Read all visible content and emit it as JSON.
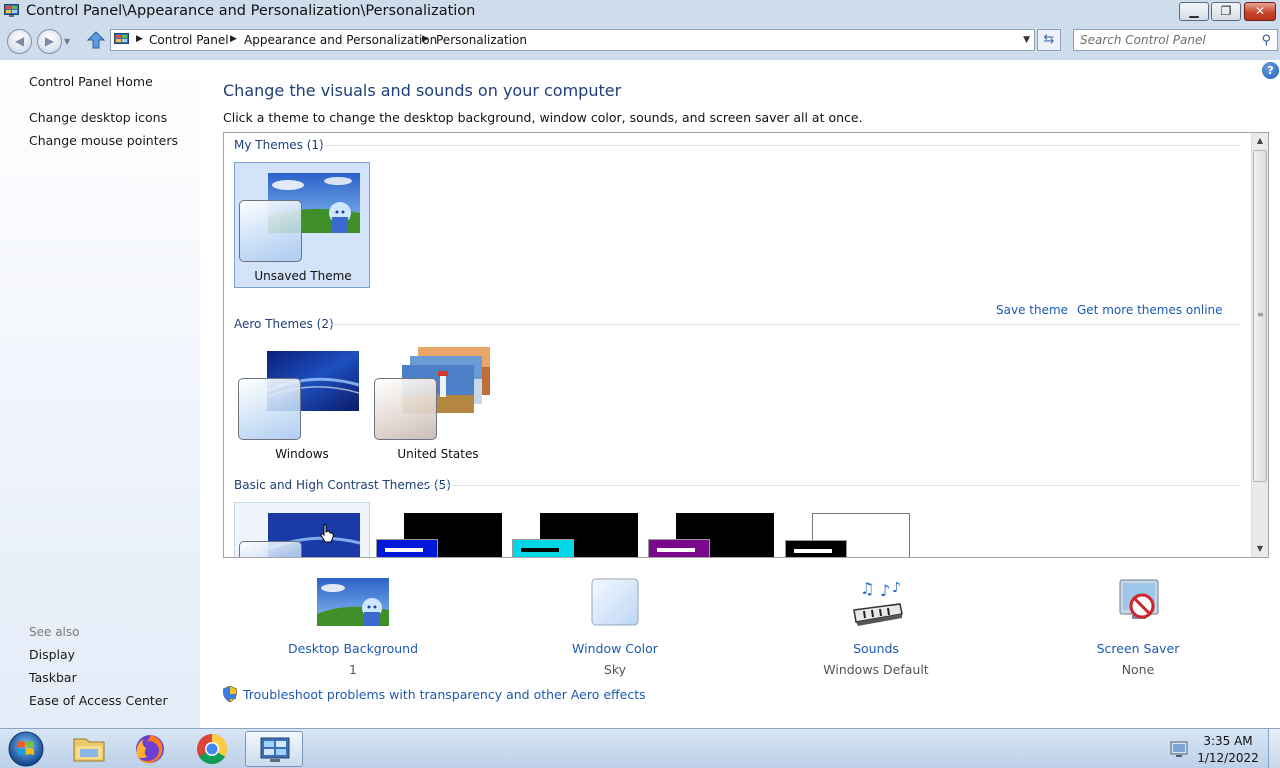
{
  "window": {
    "title": "Control Panel\\Appearance and Personalization\\Personalization"
  },
  "address": {
    "crumbs": [
      "Control Panel",
      "Appearance and Personalization",
      "Personalization"
    ]
  },
  "search": {
    "placeholder": "Search Control Panel"
  },
  "left_pane": {
    "home": "Control Panel Home",
    "tasks": [
      "Change desktop icons",
      "Change mouse pointers"
    ],
    "see_also_label": "See also",
    "see_also": [
      "Display",
      "Taskbar",
      "Ease of Access Center"
    ]
  },
  "main": {
    "title": "Change the visuals and sounds on your computer",
    "description": "Click a theme to change the desktop background, window color, sounds, and screen saver all at once.",
    "groups": {
      "my": {
        "header": "My Themes (1)",
        "themes": [
          "Unsaved Theme"
        ]
      },
      "aero": {
        "header": "Aero Themes (2)",
        "themes": [
          "Windows",
          "United States"
        ]
      },
      "basic": {
        "header": "Basic and High Contrast Themes (5)"
      }
    },
    "links": {
      "save": "Save theme",
      "more": "Get more themes online"
    },
    "settings": [
      {
        "name": "Desktop Background",
        "value": "1"
      },
      {
        "name": "Window Color",
        "value": "Sky"
      },
      {
        "name": "Sounds",
        "value": "Windows Default"
      },
      {
        "name": "Screen Saver",
        "value": "None"
      }
    ],
    "troubleshoot": "Troubleshoot problems with transparency and other Aero effects"
  },
  "taskbar": {
    "time": "3:35 AM",
    "date": "1/12/2022"
  },
  "colors": {
    "link": "#1d59b3",
    "heading": "#1e3f78",
    "chrome": "#cfdcec",
    "selection": "#d3e4fa"
  }
}
